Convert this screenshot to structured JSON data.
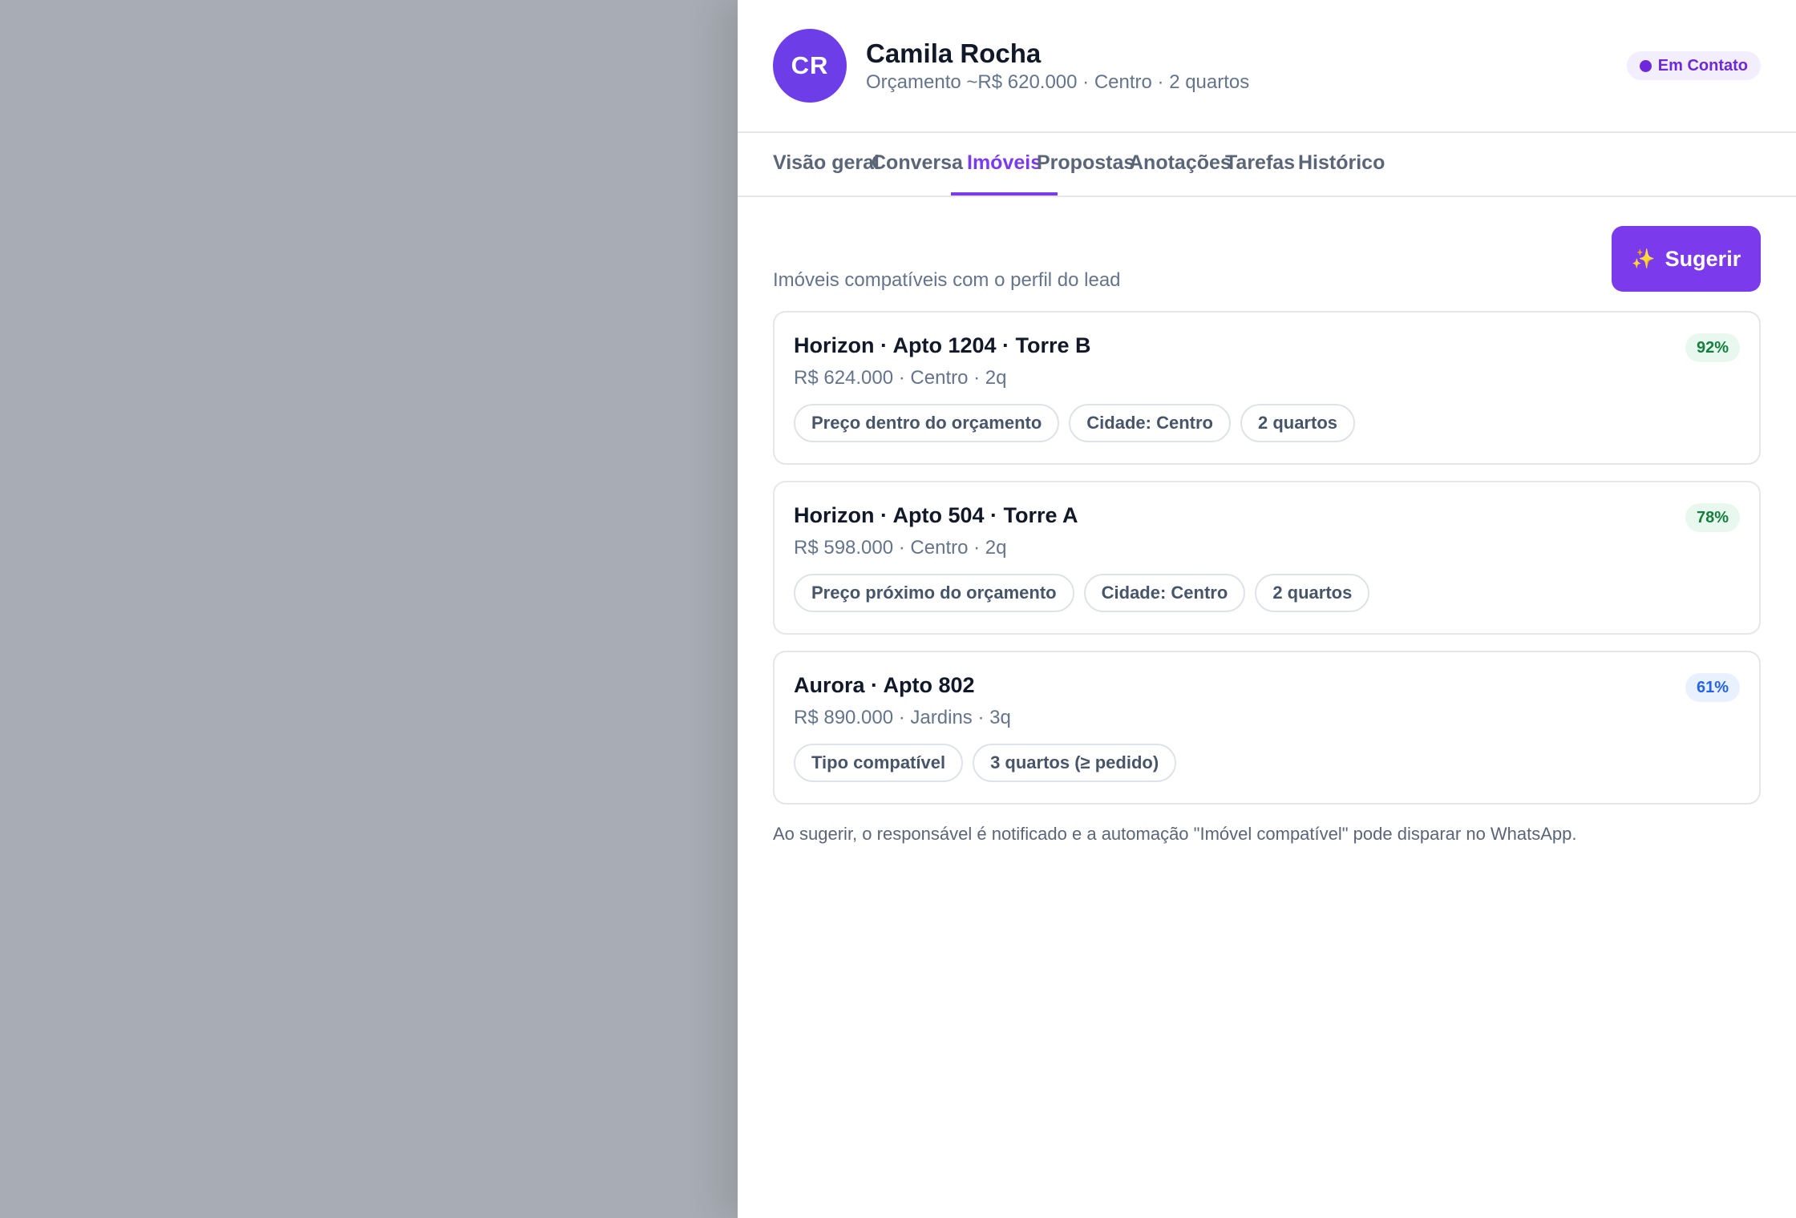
{
  "lead": {
    "initials": "CR",
    "name": "Camila Rocha",
    "subtitle": "Orçamento ~R$ 620.000 · Centro · 2 quartos",
    "status": "Em Contato"
  },
  "tabs": [
    {
      "label": "Visão geral",
      "active": false
    },
    {
      "label": "Conversa",
      "active": false
    },
    {
      "label": "Imóveis",
      "active": true
    },
    {
      "label": "Propostas",
      "active": false
    },
    {
      "label": "Anotações",
      "active": false
    },
    {
      "label": "Tarefas",
      "active": false
    },
    {
      "label": "Histórico",
      "active": false
    }
  ],
  "section": {
    "caption": "Imóveis compatíveis com o perfil do lead",
    "suggest_label": "Sugerir",
    "suggest_icon": "sparkles-icon"
  },
  "properties": [
    {
      "title": "Horizon · Apto 1204 · Torre B",
      "details": "R$ 624.000 · Centro · 2q",
      "score": "92%",
      "score_color": "#15803d",
      "reasons": [
        "Preço dentro do orçamento",
        "Cidade: Centro",
        "2 quartos"
      ]
    },
    {
      "title": "Horizon · Apto 504 · Torre A",
      "details": "R$ 598.000 · Centro · 2q",
      "score": "78%",
      "score_color": "#15803d",
      "reasons": [
        "Preço próximo do orçamento",
        "Cidade: Centro",
        "2 quartos"
      ]
    },
    {
      "title": "Aurora · Apto 802",
      "details": "R$ 890.000 · Jardins · 3q",
      "score": "61%",
      "score_color": "#2563eb",
      "reasons": [
        "Tipo compatível",
        "3 quartos (≥ pedido)"
      ]
    }
  ],
  "footnote": "Ao sugerir, o responsável é notificado e a automação \"Imóvel compatível\" pode disparar no WhatsApp.",
  "colors": {
    "accent": "#7c3aed",
    "backdrop": "#a8acb4"
  }
}
